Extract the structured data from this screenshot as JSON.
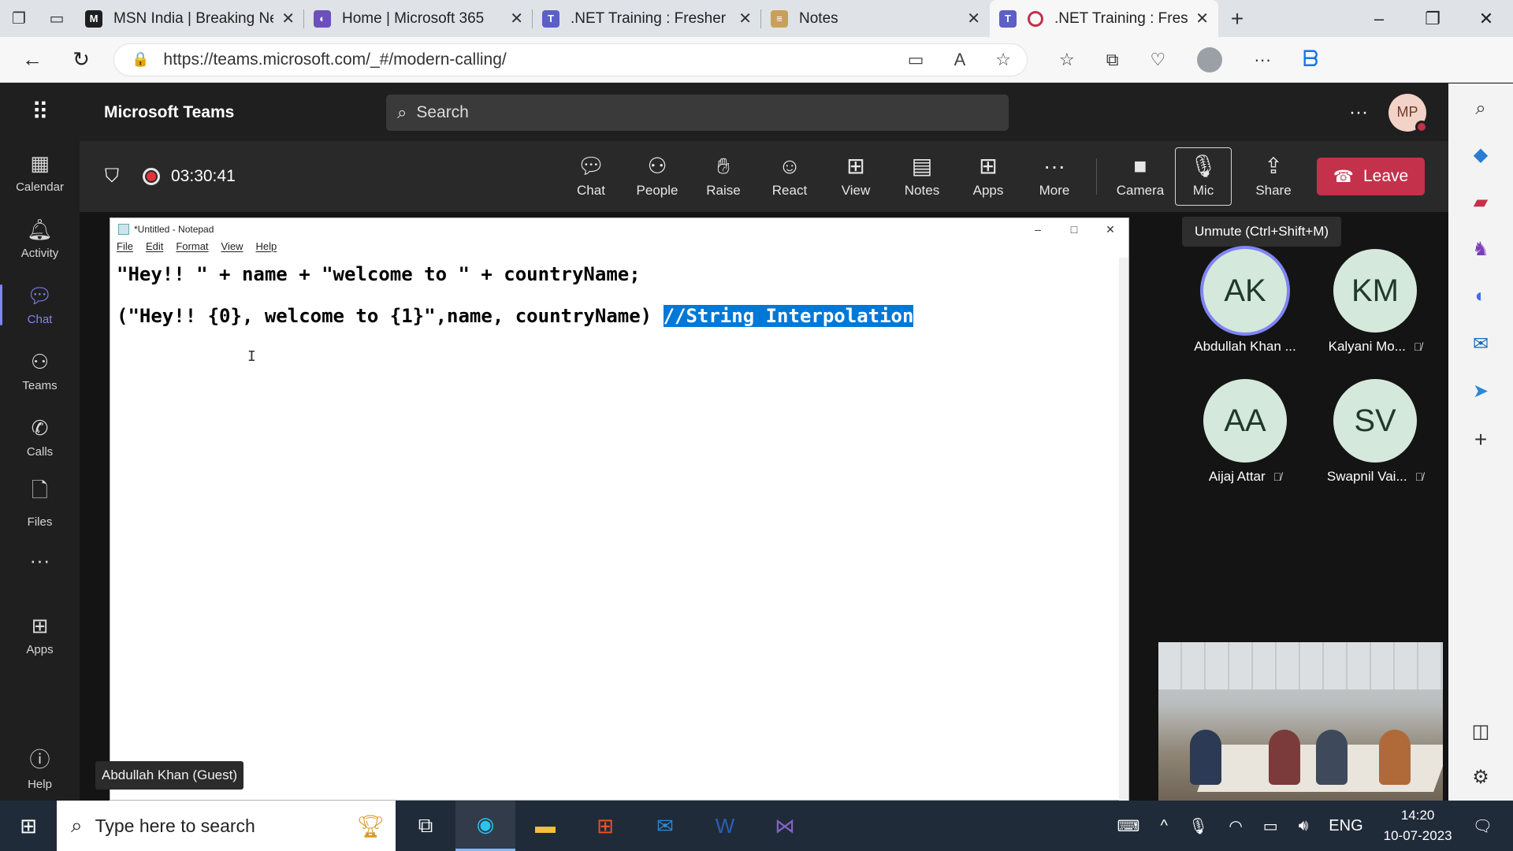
{
  "browser": {
    "tabs": [
      {
        "label": "MSN India | Breaking Ne",
        "icon": "msn-icon",
        "color": "#1f1f1f"
      },
      {
        "label": "Home | Microsoft 365",
        "icon": "microsoft365-icon",
        "color": "#6b4fbb"
      },
      {
        "label": ".NET Training : Fresher B",
        "icon": "teams-icon",
        "color": "#5b5fc7"
      },
      {
        "label": "Notes",
        "icon": "notes-icon",
        "color": "#c8a05a"
      },
      {
        "label": ".NET Training : Fres",
        "icon": "teams-icon",
        "color": "#5b5fc7"
      }
    ],
    "url": "https://teams.microsoft.com/_#/modern-calling/"
  },
  "teams": {
    "app_title": "Microsoft Teams",
    "search_placeholder": "Search",
    "user_initials": "MP",
    "rail": [
      {
        "label": "Calendar",
        "icon": "calendar-icon"
      },
      {
        "label": "Activity",
        "icon": "bell-icon"
      },
      {
        "label": "Chat",
        "icon": "chat-icon"
      },
      {
        "label": "Teams",
        "icon": "teams-icon"
      },
      {
        "label": "Calls",
        "icon": "phone-icon"
      },
      {
        "label": "Files",
        "icon": "file-icon"
      },
      {
        "label": "Apps",
        "icon": "apps-icon"
      },
      {
        "label": "Help",
        "icon": "help-icon"
      }
    ]
  },
  "meeting": {
    "timer": "03:30:41",
    "controls": [
      "Chat",
      "People",
      "Raise",
      "React",
      "View",
      "Notes",
      "Apps",
      "More",
      "Camera",
      "Mic",
      "Share"
    ],
    "leave_label": "Leave",
    "tooltip": "Unmute (Ctrl+Shift+M)",
    "speaker_label": "Abdullah Khan (Guest)",
    "participants": [
      {
        "initials": "AK",
        "name": "Abdullah Khan ...",
        "muted": false,
        "speaking": true,
        "color": "#d5e8dc"
      },
      {
        "initials": "KM",
        "name": "Kalyani Mo...",
        "muted": true,
        "speaking": false,
        "color": "#d5e8dc"
      },
      {
        "initials": "AA",
        "name": "Aijaj Attar",
        "muted": true,
        "speaking": false,
        "color": "#d5e8dc"
      },
      {
        "initials": "SV",
        "name": "Swapnil Vai...",
        "muted": true,
        "speaking": false,
        "color": "#d5e8dc"
      }
    ]
  },
  "notepad": {
    "title": "*Untitled - Notepad",
    "menu": [
      "File",
      "Edit",
      "Format",
      "View",
      "Help"
    ],
    "line1": "\"Hey!! \" + name + \"welcome to \" + countryName;",
    "line2_plain": "(\"Hey!! {0}, welcome to {1}\",name, countryName) ",
    "line2_selected": "//String Interpolation"
  },
  "taskbar": {
    "search_placeholder": "Type here to search",
    "language": "ENG",
    "time": "14:20",
    "date": "10-07-2023"
  }
}
